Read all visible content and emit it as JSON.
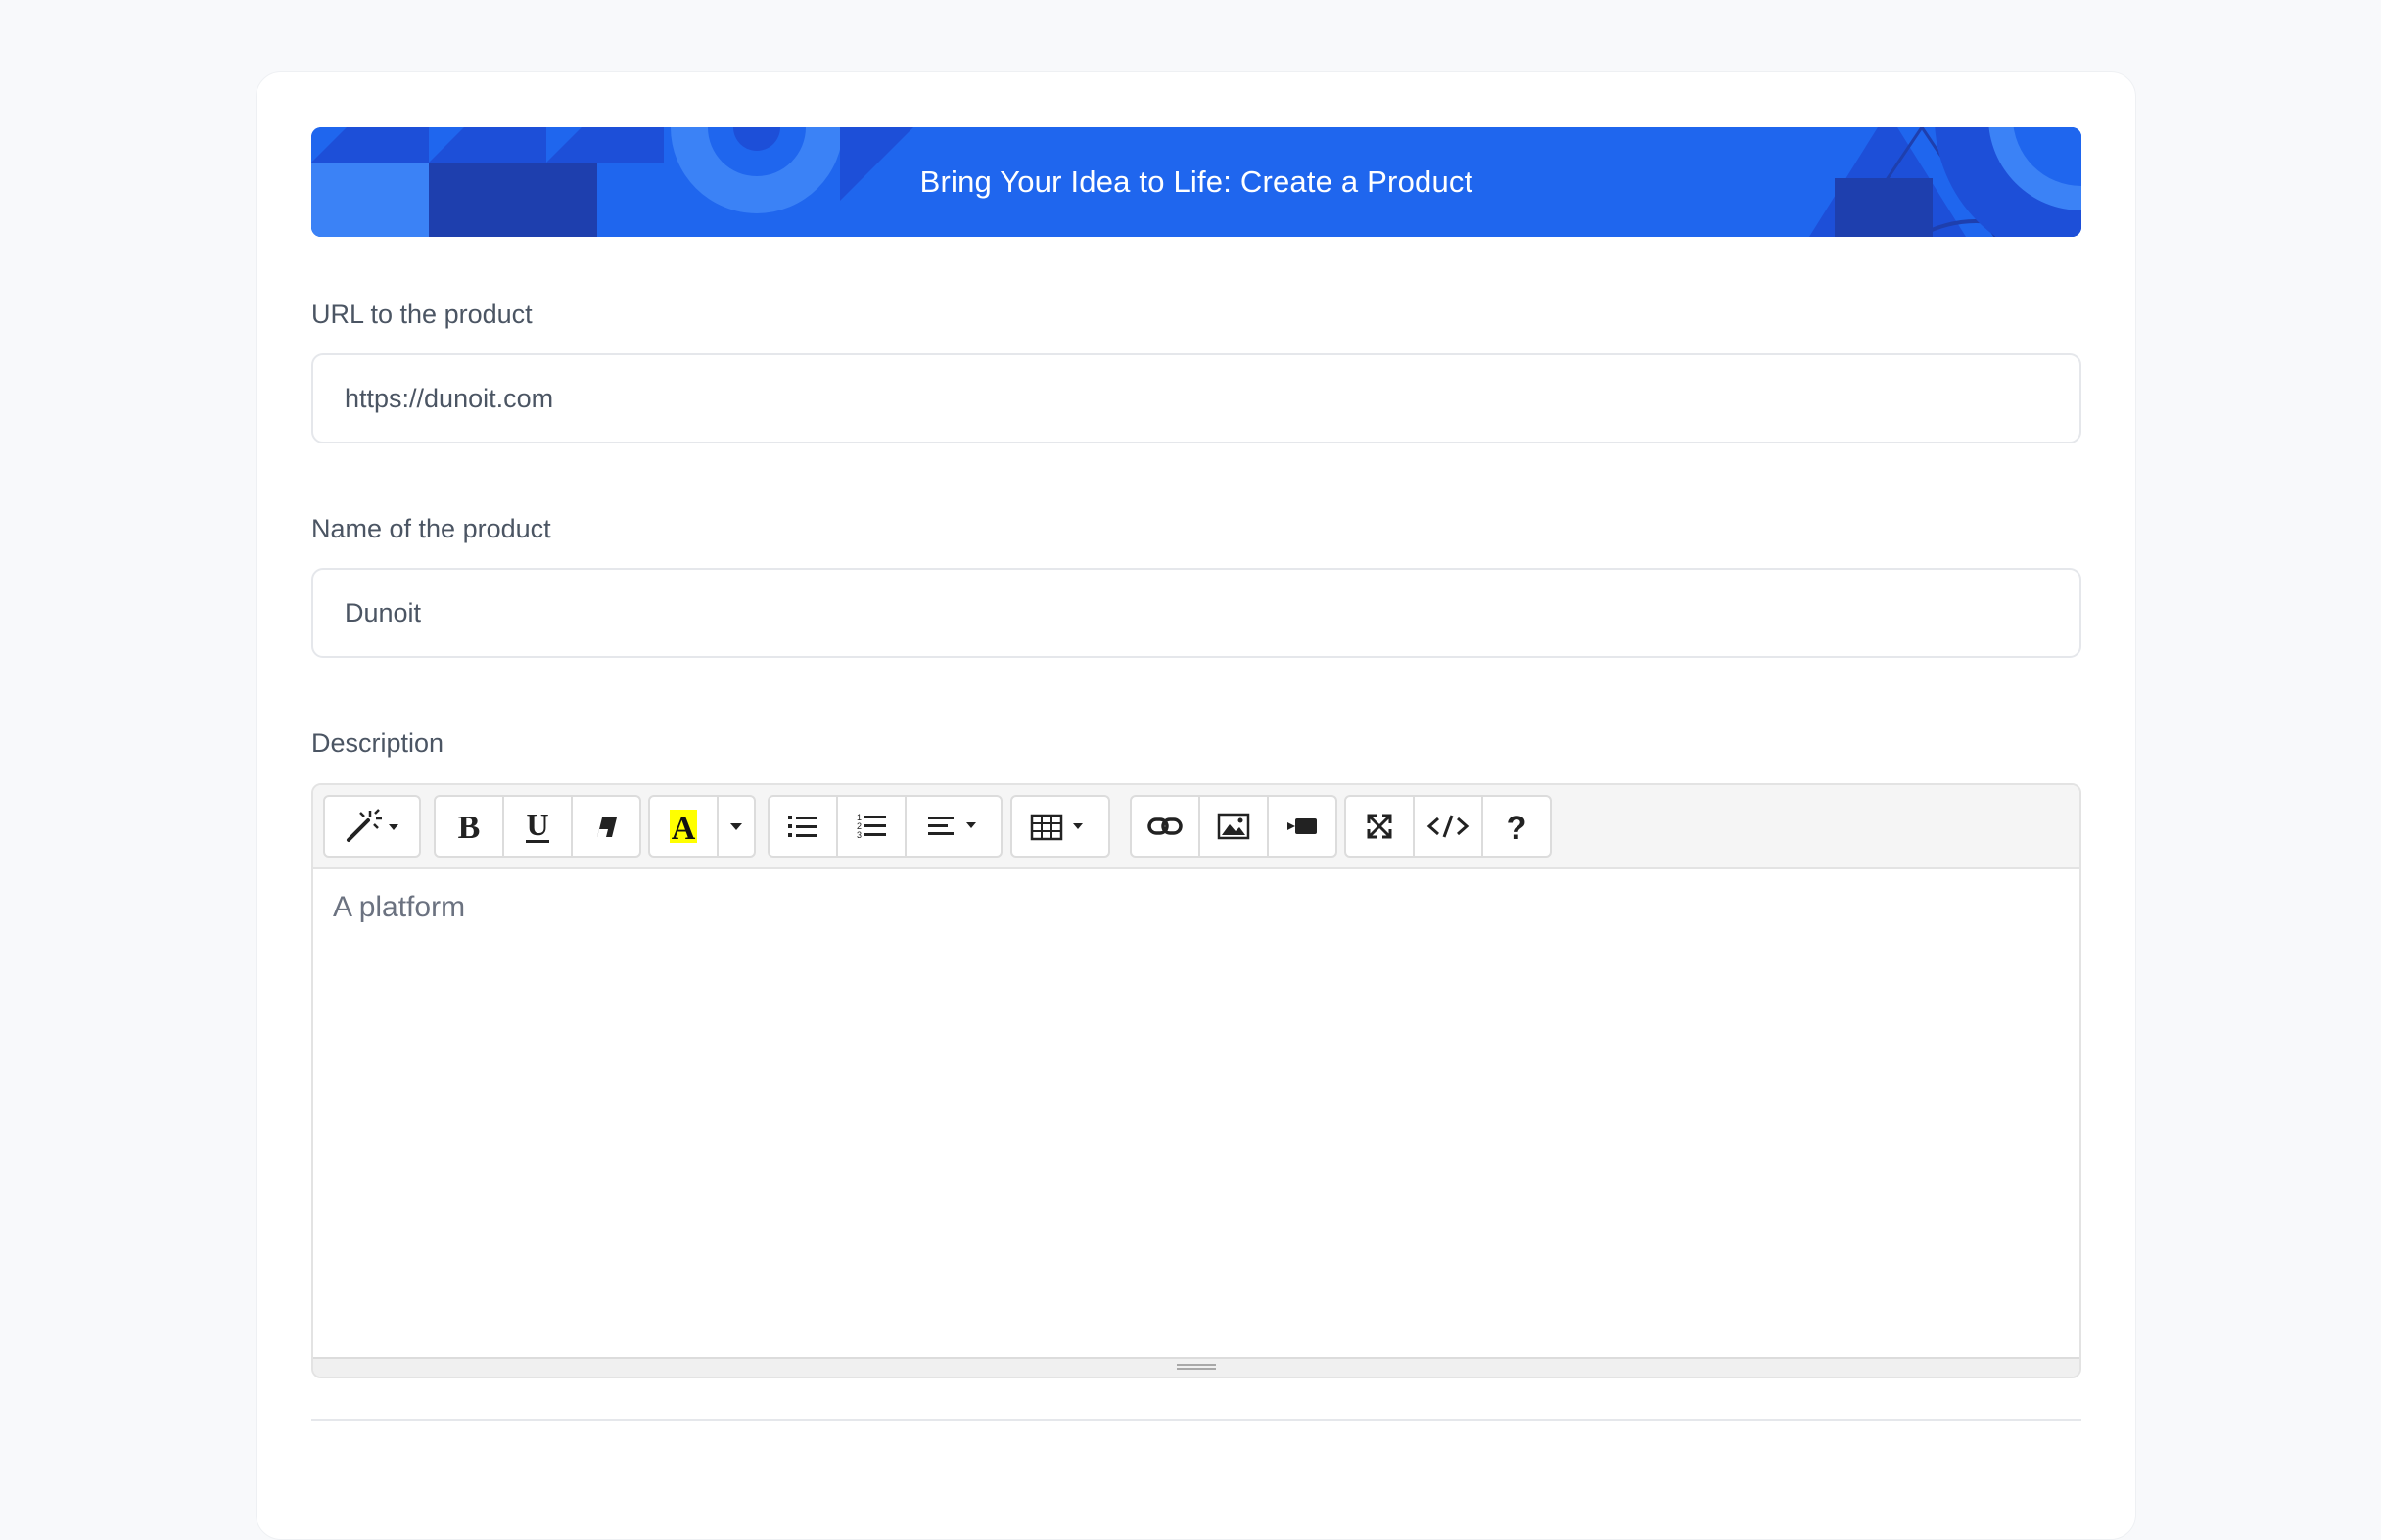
{
  "banner": {
    "title": "Bring Your Idea to Life: Create a Product",
    "color": "#1f66ee"
  },
  "fields": {
    "url": {
      "label": "URL to the product",
      "value": "https://dunoit.com"
    },
    "name": {
      "label": "Name of the product",
      "value": "Dunoit"
    },
    "description": {
      "label": "Description",
      "value": "A platform"
    }
  },
  "toolbar": {
    "groups": [
      [
        "magic-wand-icon"
      ],
      [
        "bold-icon",
        "underline-icon",
        "eraser-icon"
      ],
      [
        "text-color-icon"
      ],
      [
        "unordered-list-icon",
        "ordered-list-icon",
        "align-icon"
      ],
      [
        "table-icon"
      ],
      [
        "link-icon",
        "image-icon",
        "video-icon"
      ],
      [
        "fullscreen-icon",
        "code-view-icon",
        "help-icon"
      ]
    ],
    "highlight_color": "#ffff00"
  }
}
